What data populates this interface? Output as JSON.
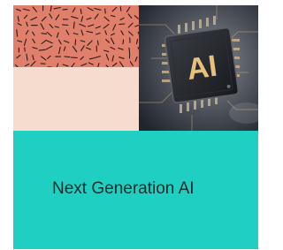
{
  "card": {
    "headline": "Next Generation AI",
    "chip_label": "AI"
  },
  "colors": {
    "pattern_background": "#e0806c",
    "pattern_strokes": "#2b1a16",
    "blush_tile": "#f6dccf",
    "teal_panel": "#1fd0c2",
    "headline_text": "#1b2b2a",
    "chip_label": "#e8c07a"
  },
  "icons": {
    "pattern": "confetti-dash-pattern",
    "photo": "ai-microchip-photo"
  }
}
